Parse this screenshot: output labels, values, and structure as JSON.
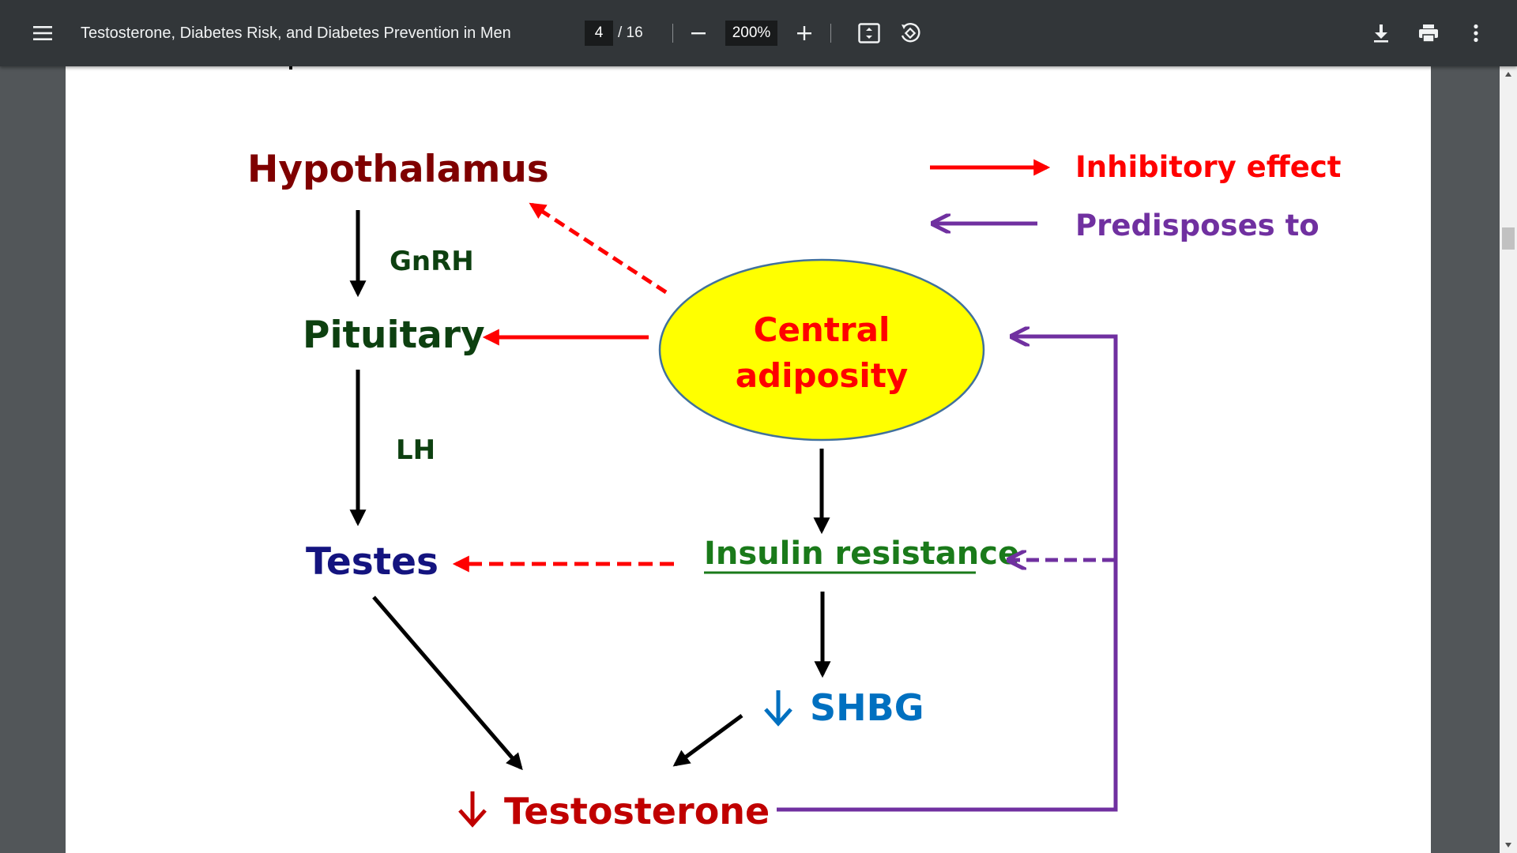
{
  "toolbar": {
    "title": "Testosterone, Diabetes Risk, and Diabetes Prevention in Men",
    "page_current": "4",
    "page_total": "/ 16",
    "zoom": "200%"
  },
  "diagram": {
    "hypothalamus": "Hypothalamus",
    "gnrh": "GnRH",
    "pituitary": "Pituitary",
    "lh": "LH",
    "testes": "Testes",
    "central_line1": "Central",
    "central_line2": "adiposity",
    "insulin_resistance": "Insulin resistance",
    "shbg": "SHBG",
    "testosterone": "Testosterone",
    "legend_inhibitory": "Inhibitory effect",
    "legend_predisposes": "Predisposes to"
  },
  "colors": {
    "hypothalamus": "#7f0000",
    "dark_green": "#0d4010",
    "navy": "#14147f",
    "red": "#ff0000",
    "purple": "#7030a0",
    "green": "#1a7a1a",
    "blue": "#0070c0",
    "testosterone": "#c00000",
    "ellipse_fill": "#ffff00"
  }
}
